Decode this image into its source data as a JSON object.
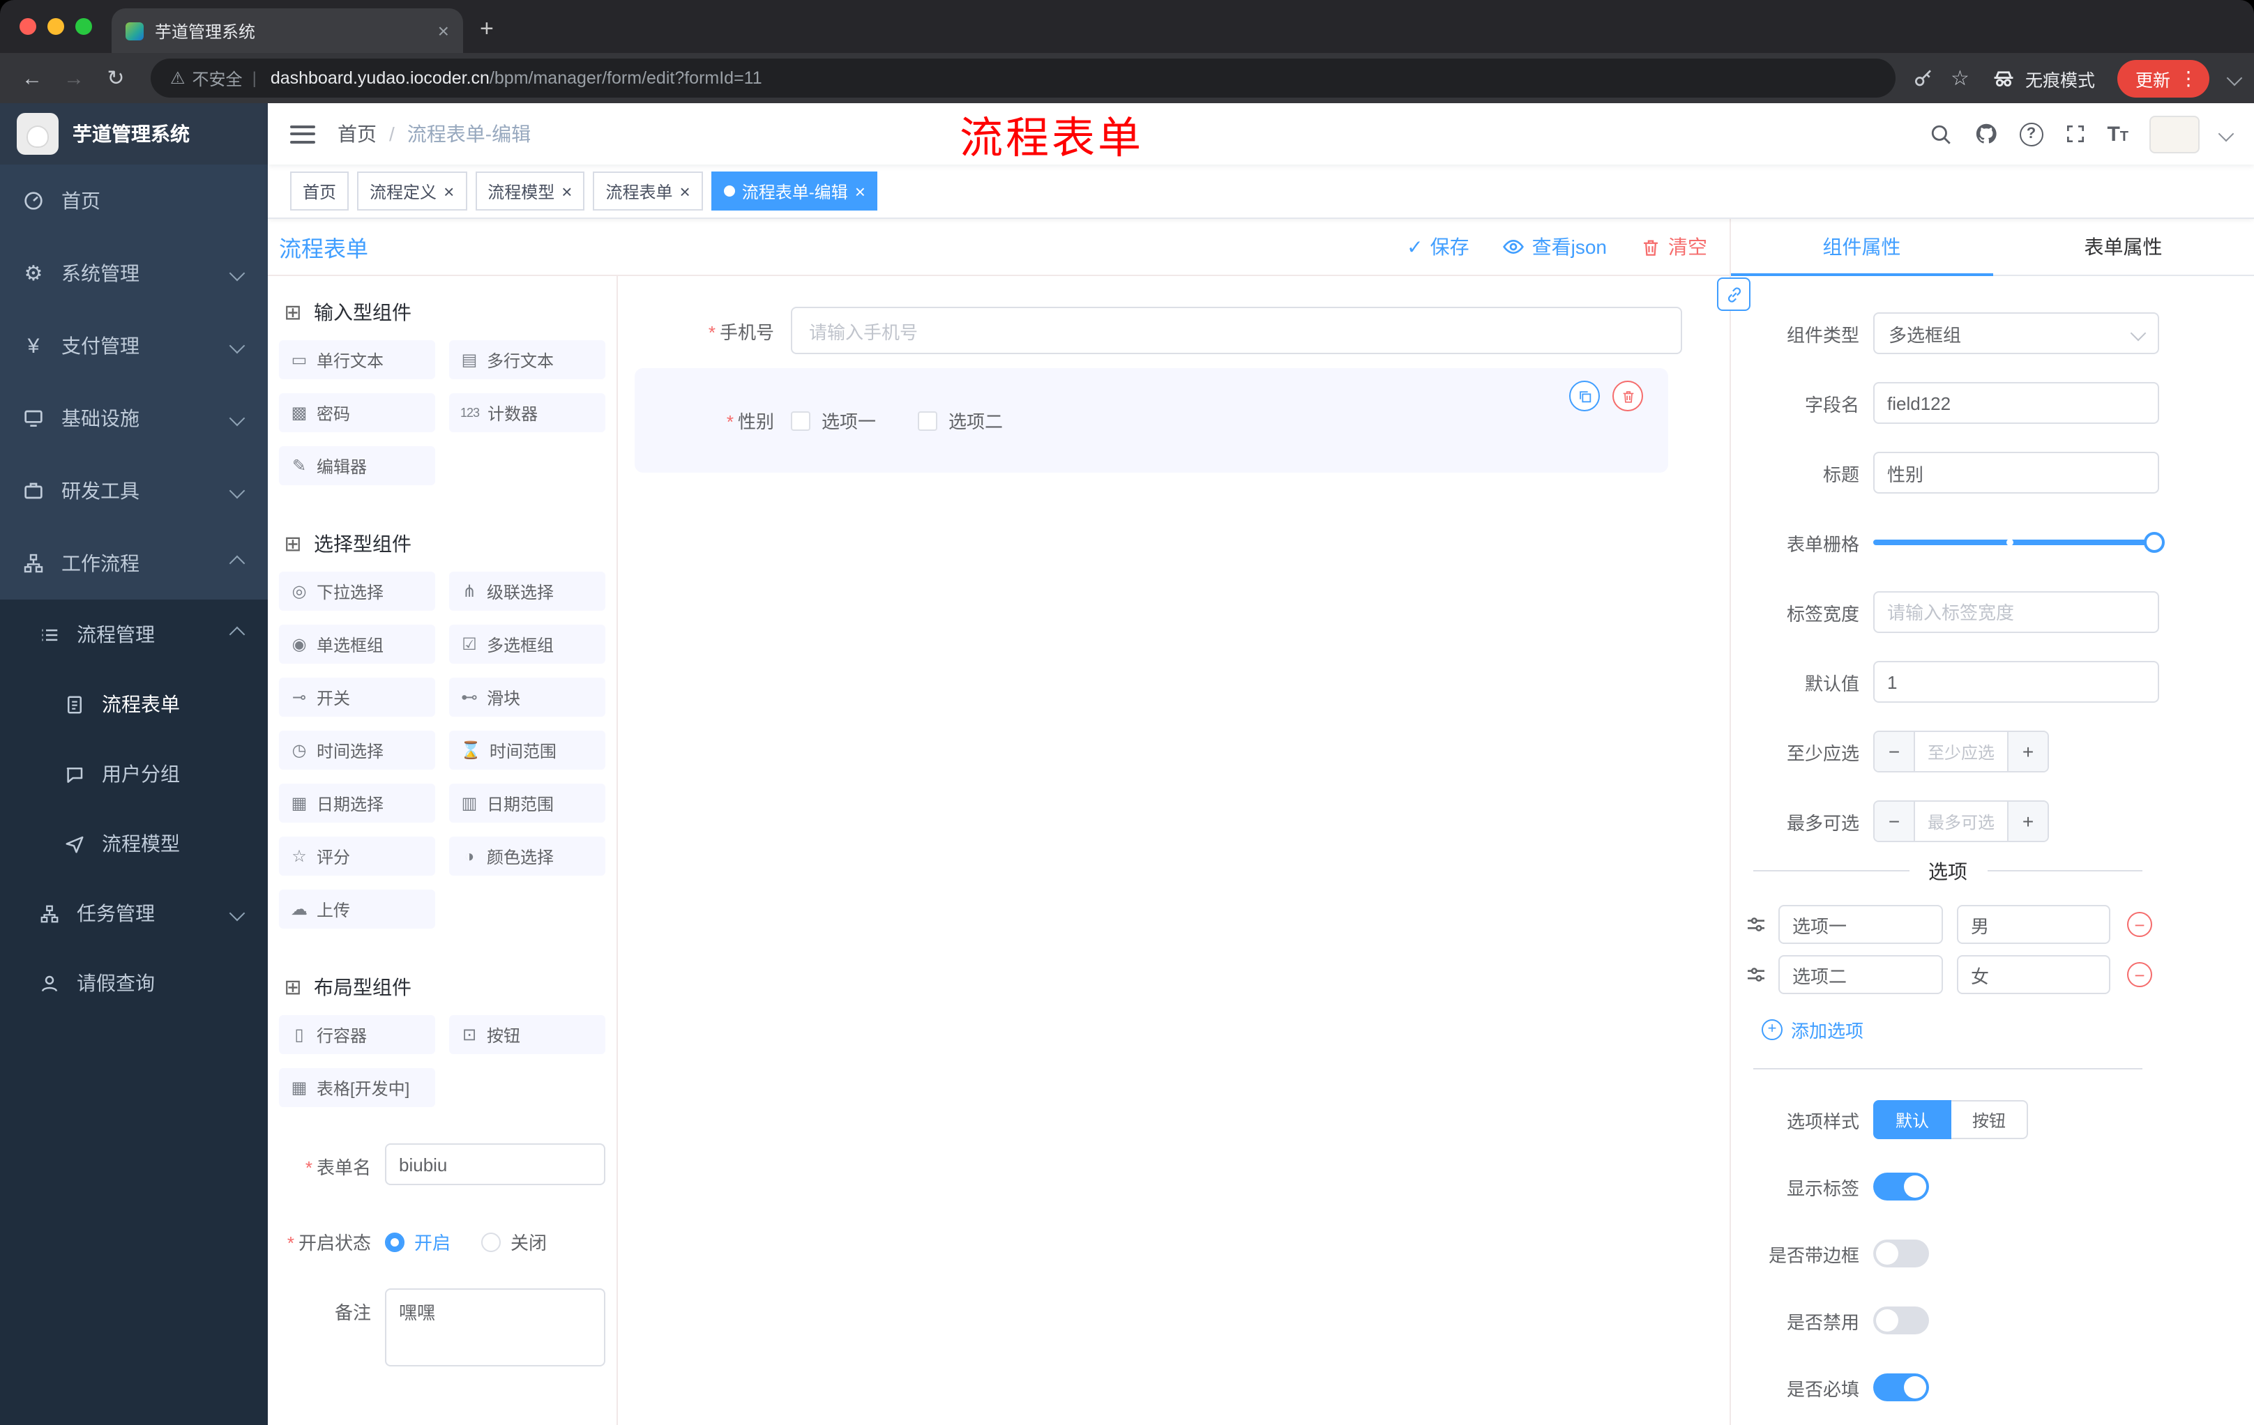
{
  "browser": {
    "tab_title": "芋道管理系统",
    "security_label": "不安全",
    "url_domain": "dashboard.yudao.iocoder.cn",
    "url_path": "/bpm/manager/form/edit?formId=11",
    "incognito_label": "无痕模式",
    "update_label": "更新"
  },
  "sidebar": {
    "app_title": "芋道管理系统",
    "items": [
      {
        "label": "首页",
        "icon": "dashboard-icon"
      },
      {
        "label": "系统管理",
        "icon": "gear-icon"
      },
      {
        "label": "支付管理",
        "icon": "payment-icon"
      },
      {
        "label": "基础设施",
        "icon": "infrastructure-icon"
      },
      {
        "label": "研发工具",
        "icon": "devtools-icon"
      },
      {
        "label": "工作流程",
        "icon": "workflow-icon"
      },
      {
        "label": "流程管理",
        "icon": "process-management-icon"
      },
      {
        "label": "流程表单",
        "icon": "process-form-icon"
      },
      {
        "label": "用户分组",
        "icon": "user-group-icon"
      },
      {
        "label": "流程模型",
        "icon": "process-model-icon"
      },
      {
        "label": "任务管理",
        "icon": "task-management-icon"
      },
      {
        "label": "请假查询",
        "icon": "leave-query-icon"
      }
    ]
  },
  "header": {
    "breadcrumb_home": "首页",
    "breadcrumb_sep": "/",
    "breadcrumb_current": "流程表单-编辑",
    "annotation": "流程表单"
  },
  "tags": [
    {
      "label": "首页"
    },
    {
      "label": "流程定义"
    },
    {
      "label": "流程模型"
    },
    {
      "label": "流程表单"
    },
    {
      "label": "流程表单-编辑",
      "active": true
    }
  ],
  "designer": {
    "title": "流程表单",
    "actions": {
      "save": "保存",
      "view_json": "查看json",
      "clear": "清空"
    },
    "palette": {
      "sections": [
        {
          "title": "输入型组件",
          "items": [
            {
              "label": "单行文本",
              "icon": "input-icon"
            },
            {
              "label": "多行文本",
              "icon": "textarea-icon"
            },
            {
              "label": "密码",
              "icon": "password-icon"
            },
            {
              "label": "计数器",
              "icon": "counter-icon"
            },
            {
              "label": "编辑器",
              "icon": "editor-icon"
            }
          ]
        },
        {
          "title": "选择型组件",
          "items": [
            {
              "label": "下拉选择",
              "icon": "select-icon"
            },
            {
              "label": "级联选择",
              "icon": "cascader-icon"
            },
            {
              "label": "单选框组",
              "icon": "radio-group-icon"
            },
            {
              "label": "多选框组",
              "icon": "checkbox-group-icon"
            },
            {
              "label": "开关",
              "icon": "switch-icon"
            },
            {
              "label": "滑块",
              "icon": "slider-icon"
            },
            {
              "label": "时间选择",
              "icon": "time-icon"
            },
            {
              "label": "时间范围",
              "icon": "time-range-icon"
            },
            {
              "label": "日期选择",
              "icon": "date-icon"
            },
            {
              "label": "日期范围",
              "icon": "date-range-icon"
            },
            {
              "label": "评分",
              "icon": "rate-icon"
            },
            {
              "label": "颜色选择",
              "icon": "color-icon"
            },
            {
              "label": "上传",
              "icon": "upload-icon"
            }
          ]
        },
        {
          "title": "布局型组件",
          "items": [
            {
              "label": "行容器",
              "icon": "row-icon"
            },
            {
              "label": "按钮",
              "icon": "button-icon"
            },
            {
              "label": "表格[开发中]",
              "icon": "table-icon"
            }
          ]
        }
      ]
    },
    "form_meta": {
      "form_name_label": "表单名",
      "form_name_value": "biubiu",
      "status_label": "开启状态",
      "status_on": "开启",
      "status_off": "关闭",
      "remark_label": "备注",
      "remark_value": "嘿嘿"
    },
    "canvas": {
      "phone_label": "手机号",
      "phone_placeholder": "请输入手机号",
      "gender_label": "性别",
      "gender_option1": "选项一",
      "gender_option2": "选项二"
    }
  },
  "properties": {
    "tab_component": "组件属性",
    "tab_form": "表单属性",
    "component_type_label": "组件类型",
    "component_type_value": "多选框组",
    "field_name_label": "字段名",
    "field_name_value": "field122",
    "title_label": "标题",
    "title_value": "性别",
    "grid_label": "表单栅格",
    "label_width_label": "标签宽度",
    "label_width_placeholder": "请输入标签宽度",
    "default_label": "默认值",
    "default_value": "1",
    "min_label": "至少应选",
    "min_placeholder": "至少应选",
    "max_label": "最多可选",
    "max_placeholder": "最多可选",
    "options_title": "选项",
    "options": [
      {
        "label": "选项一",
        "value": "男"
      },
      {
        "label": "选项二",
        "value": "女"
      }
    ],
    "add_option": "添加选项",
    "style_label": "选项样式",
    "style_default": "默认",
    "style_button": "按钮",
    "show_label_label": "显示标签",
    "border_label": "是否带边框",
    "disabled_label": "是否禁用",
    "required_label": "是否必填",
    "accent_color": "#409eff",
    "danger_color": "#f56c6c"
  }
}
